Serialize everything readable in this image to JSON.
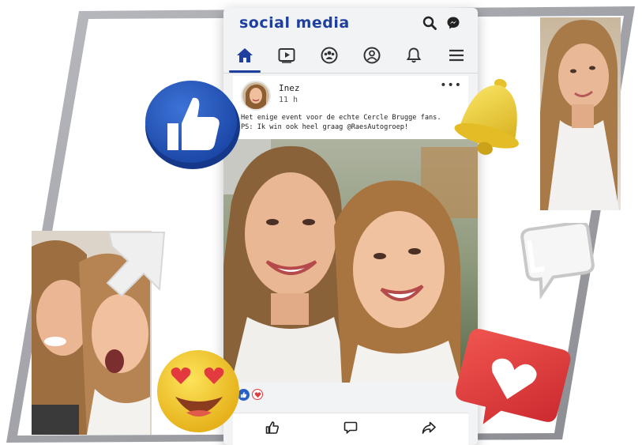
{
  "app": {
    "brand": "social media"
  },
  "nav": {
    "items": [
      {
        "name": "home",
        "icon": "home-icon",
        "active": true
      },
      {
        "name": "video",
        "icon": "play-icon",
        "active": false
      },
      {
        "name": "groups",
        "icon": "groups-icon",
        "active": false
      },
      {
        "name": "profile",
        "icon": "user-icon",
        "active": false
      },
      {
        "name": "notifications",
        "icon": "bell-icon",
        "active": false
      },
      {
        "name": "menu",
        "icon": "hamburger-icon",
        "active": false
      }
    ]
  },
  "header_icons": [
    "search-icon",
    "messenger-icon"
  ],
  "post": {
    "author": "Inez",
    "time": "11 h",
    "caption_line1": "Het enige event voor de echte Cercle Brugge fans.",
    "caption_line2": "PS: Ik win ook heel graag @RaesAutogroep!",
    "reactions": [
      "like-reaction",
      "love-reaction"
    ]
  },
  "actions": [
    "like-icon",
    "comment-icon",
    "share-icon"
  ],
  "colors": {
    "brand": "#1e3f9e",
    "frame": "#9a9ca2",
    "like_blue": "#2a5fc4",
    "heart_red": "#e23a3f",
    "bell_yellow": "#f2d33a",
    "emoji_yellow": "#f4cc2a"
  },
  "decorations": [
    "thumbs-up-bubble",
    "bell-3d",
    "speech-bubble-outline",
    "arrow-cursor",
    "heart-eyes-emoji",
    "heart-notification"
  ]
}
